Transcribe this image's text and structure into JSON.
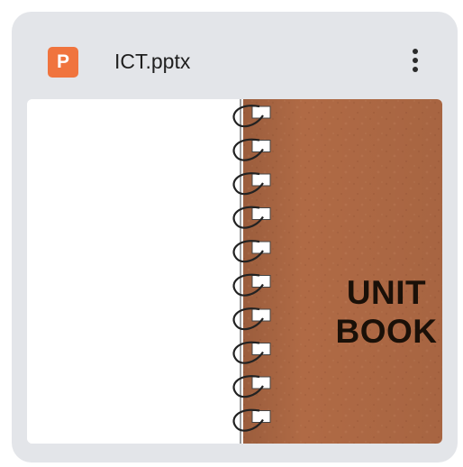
{
  "file": {
    "type_icon_letter": "P",
    "type_icon_name": "powerpoint-icon",
    "type_color": "#f0743e",
    "name": "ICT.pptx"
  },
  "menu": {
    "icon_name": "more-vertical-icon"
  },
  "thumbnail": {
    "cover_color": "#b06a45",
    "title_lines": [
      "UNIT",
      "BOOK"
    ]
  }
}
